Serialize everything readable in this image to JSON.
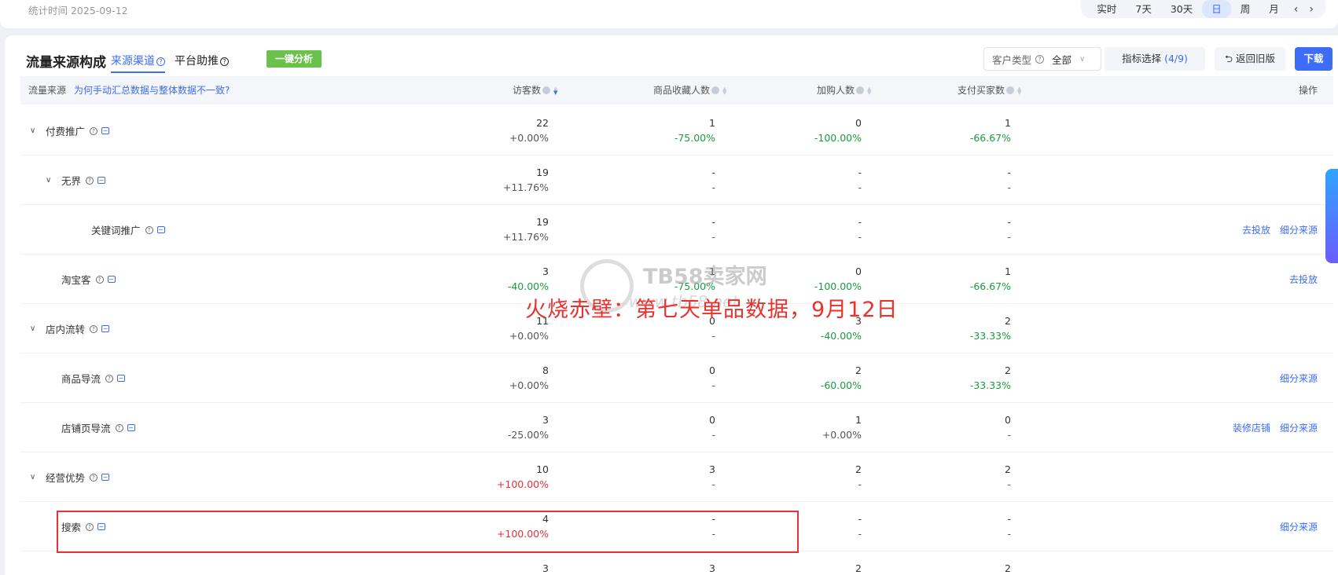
{
  "topbar": {
    "stat_time": "统计时间 2025-09-12",
    "periods": [
      "实时",
      "7天",
      "30天",
      "日",
      "周",
      "月"
    ],
    "prev": "‹",
    "next": "›"
  },
  "card": {
    "title": "流量来源构成",
    "tab_source": "来源渠道",
    "tab_platform": "平台助推",
    "one_click": "一键分析",
    "customer_label": "客户类型",
    "customer_value": "全部",
    "metric_label": "指标选择",
    "metric_count": "(4/9)",
    "back_label": "返回旧版",
    "download_label": "下载"
  },
  "table": {
    "headers": {
      "source": "流量来源",
      "hint": "为何手动汇总数据与整体数据不一致?",
      "visitors": "访客数",
      "fav": "商品收藏人数",
      "cart": "加购人数",
      "buyers": "支付买家数",
      "ops": "操作"
    },
    "rows": [
      {
        "name": "付费推广",
        "level": 0,
        "caret": "∨",
        "v1": "22",
        "d1": "+0.00%",
        "c1": "gray",
        "v2": "1",
        "d2": "-75.00%",
        "c2": "green",
        "v3": "0",
        "d3": "-100.00%",
        "c3": "green",
        "v4": "1",
        "d4": "-66.67%",
        "c4": "green",
        "ops": []
      },
      {
        "name": "无界",
        "level": 1,
        "caret": "∨",
        "v1": "19",
        "d1": "+11.76%",
        "c1": "gray",
        "v2": "-",
        "d2": "-",
        "c2": "gray",
        "v3": "-",
        "d3": "-",
        "c3": "gray",
        "v4": "-",
        "d4": "-",
        "c4": "gray",
        "ops": []
      },
      {
        "name": "关键词推广",
        "level": 2,
        "caret": "",
        "v1": "19",
        "d1": "+11.76%",
        "c1": "gray",
        "v2": "-",
        "d2": "-",
        "c2": "gray",
        "v3": "-",
        "d3": "-",
        "c3": "gray",
        "v4": "-",
        "d4": "-",
        "c4": "gray",
        "ops": [
          "去投放",
          "细分来源"
        ]
      },
      {
        "name": "淘宝客",
        "level": 1,
        "caret": "",
        "v1": "3",
        "d1": "-40.00%",
        "c1": "green",
        "v2": "1",
        "d2": "-75.00%",
        "c2": "green",
        "v3": "0",
        "d3": "-100.00%",
        "c3": "green",
        "v4": "1",
        "d4": "-66.67%",
        "c4": "green",
        "ops": [
          "去投放"
        ]
      },
      {
        "name": "店内流转",
        "level": 0,
        "caret": "∨",
        "v1": "11",
        "d1": "+0.00%",
        "c1": "gray",
        "v2": "0",
        "d2": "-",
        "c2": "gray",
        "v3": "3",
        "d3": "-40.00%",
        "c3": "green",
        "v4": "2",
        "d4": "-33.33%",
        "c4": "green",
        "ops": []
      },
      {
        "name": "商品导流",
        "level": 1,
        "caret": "",
        "v1": "8",
        "d1": "+0.00%",
        "c1": "gray",
        "v2": "0",
        "d2": "-",
        "c2": "gray",
        "v3": "2",
        "d3": "-60.00%",
        "c3": "green",
        "v4": "2",
        "d4": "-33.33%",
        "c4": "green",
        "ops": [
          "细分来源"
        ]
      },
      {
        "name": "店铺页导流",
        "level": 1,
        "caret": "",
        "v1": "3",
        "d1": "-25.00%",
        "c1": "gray",
        "v2": "0",
        "d2": "-",
        "c2": "gray",
        "v3": "1",
        "d3": "+0.00%",
        "c3": "gray",
        "v4": "0",
        "d4": "-",
        "c4": "gray",
        "ops": [
          "装修店铺",
          "细分来源"
        ]
      },
      {
        "name": "经营优势",
        "level": 0,
        "caret": "∨",
        "v1": "10",
        "d1": "+100.00%",
        "c1": "red",
        "v2": "3",
        "d2": "-",
        "c2": "gray",
        "v3": "2",
        "d3": "-",
        "c3": "gray",
        "v4": "2",
        "d4": "-",
        "c4": "gray",
        "ops": []
      },
      {
        "name": "搜索",
        "level": 1,
        "caret": "",
        "v1": "4",
        "d1": "+100.00%",
        "c1": "red",
        "v2": "-",
        "d2": "-",
        "c2": "gray",
        "v3": "-",
        "d3": "-",
        "c3": "gray",
        "v4": "-",
        "d4": "-",
        "c4": "gray",
        "ops": [
          "细分来源"
        ]
      },
      {
        "name": "",
        "level": 1,
        "caret": "",
        "v1": "3",
        "d1": "",
        "c1": "gray",
        "v2": "3",
        "d2": "",
        "c2": "gray",
        "v3": "2",
        "d3": "",
        "c3": "gray",
        "v4": "2",
        "d4": "",
        "c4": "gray",
        "ops": []
      }
    ]
  },
  "overlay": {
    "caption": "火烧赤壁：第七天单品数据，9月12日",
    "watermark": "TB58卖家网",
    "watermark_url": "www.tb58.net"
  }
}
